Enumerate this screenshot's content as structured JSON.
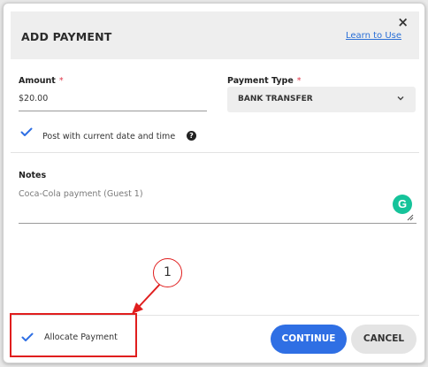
{
  "dialog": {
    "title": "ADD PAYMENT",
    "learn_link": "Learn to Use",
    "close_glyph": "×"
  },
  "amount": {
    "label": "Amount",
    "required_mark": "*",
    "value": "$20.00"
  },
  "payment_type": {
    "label": "Payment Type",
    "required_mark": "*",
    "selected": "BANK TRANSFER"
  },
  "post_option": {
    "checked": true,
    "label": "Post with current date and time",
    "help_glyph": "?"
  },
  "notes": {
    "label": "Notes",
    "value": "Coca-Cola payment (Guest 1)",
    "grammarly_glyph": "G"
  },
  "callout": {
    "number": "1"
  },
  "allocate": {
    "checked": true,
    "label": "Allocate Payment"
  },
  "buttons": {
    "continue_label": "CONTINUE",
    "cancel_label": "CANCEL"
  },
  "colors": {
    "accent": "#2f6fe4",
    "highlight": "#e01e1e",
    "required": "#e0374a",
    "grammarly": "#15c39a"
  },
  "icons": [
    "close-icon",
    "chevron-down-icon",
    "checkmark-icon",
    "help-icon",
    "grammarly-icon",
    "resize-handle-icon",
    "arrow-icon"
  ]
}
